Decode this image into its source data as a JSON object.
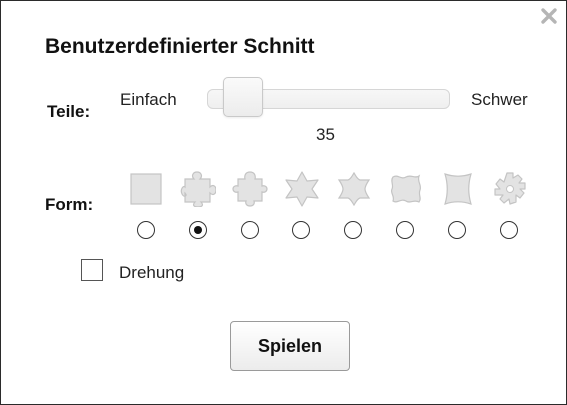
{
  "dialog": {
    "title": "Benutzerdefinierter Schnitt",
    "close_icon": "close-icon"
  },
  "pieces": {
    "label": "Teile:",
    "easy_label": "Einfach",
    "hard_label": "Schwer",
    "value": "35",
    "slider_position_fraction": 0.08
  },
  "shape": {
    "label": "Form:",
    "options": [
      {
        "icon": "square-piece-icon",
        "selected": false
      },
      {
        "icon": "classic-puzzle-piece-icon",
        "selected": true
      },
      {
        "icon": "cross-puzzle-piece-icon",
        "selected": false
      },
      {
        "icon": "star-puzzle-piece-icon",
        "selected": false
      },
      {
        "icon": "hexagram-puzzle-piece-icon",
        "selected": false
      },
      {
        "icon": "wavy-puzzle-piece-icon",
        "selected": false
      },
      {
        "icon": "curved-tile-icon",
        "selected": false
      },
      {
        "icon": "gear-puzzle-piece-icon",
        "selected": false
      }
    ]
  },
  "rotation": {
    "label": "Drehung",
    "checked": false
  },
  "actions": {
    "play_label": "Spielen"
  },
  "colors": {
    "piece_fill": "#e3e3e3",
    "piece_stroke": "#c4c4c4"
  }
}
